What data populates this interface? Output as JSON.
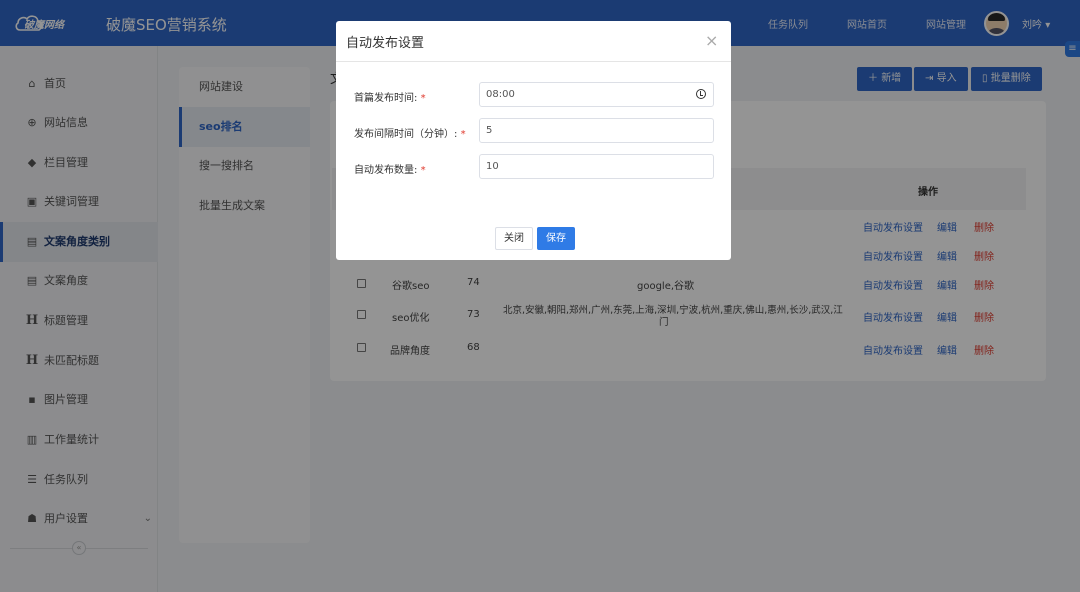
{
  "header": {
    "logo_text": "破魔网络",
    "title": "破魔SEO营销系统",
    "nav": [
      "任务队列",
      "网站首页",
      "网站管理"
    ],
    "user_name": "刘吟"
  },
  "sidebar": {
    "items": [
      {
        "label": "首页",
        "icon": "home-icon"
      },
      {
        "label": "网站信息",
        "icon": "globe-icon"
      },
      {
        "label": "栏目管理",
        "icon": "tag-icon"
      },
      {
        "label": "关键词管理",
        "icon": "file-search-icon"
      },
      {
        "label": "文案角度类别",
        "icon": "document-icon",
        "active": true
      },
      {
        "label": "文案角度",
        "icon": "document-icon"
      },
      {
        "label": "标题管理",
        "icon": "heading-icon"
      },
      {
        "label": "未匹配标题",
        "icon": "heading-icon"
      },
      {
        "label": "图片管理",
        "icon": "image-icon"
      },
      {
        "label": "工作量统计",
        "icon": "stats-icon"
      },
      {
        "label": "任务队列",
        "icon": "list-icon"
      },
      {
        "label": "用户设置",
        "icon": "users-icon"
      }
    ]
  },
  "submenu": {
    "items": [
      {
        "label": "网站建设"
      },
      {
        "label": "seo排名",
        "active": true
      },
      {
        "label": "搜一搜排名"
      },
      {
        "label": "批量生成文案"
      }
    ]
  },
  "main": {
    "heading": "文",
    "buttons": {
      "add": "新增",
      "import": "导入",
      "batch_delete": "批量删除"
    },
    "ops_header": "操作",
    "rows": [
      {
        "name": "",
        "id": "",
        "keywords": ""
      },
      {
        "name": "",
        "id": "",
        "keywords": ""
      },
      {
        "name": "谷歌seo",
        "id": "74",
        "keywords": "google,谷歌"
      },
      {
        "name": "seo优化",
        "id": "73",
        "keywords_line1": "北京,安徽,朝阳,郑州,广州,东莞,上海,深圳,宁波,杭州,重庆,佛山,惠州,长沙,武汉,江",
        "keywords_line2": "门"
      },
      {
        "name": "品牌角度",
        "id": "68",
        "keywords": ""
      }
    ],
    "actions": {
      "auto_publish": "自动发布设置",
      "edit": "编辑",
      "delete": "删除"
    }
  },
  "modal": {
    "title": "自动发布设置",
    "fields": [
      {
        "label": "首篇发布时间:",
        "value": "08:00"
      },
      {
        "label": "发布间隔时间（分钟）:",
        "value": "5"
      },
      {
        "label": "自动发布数量:",
        "value": "10"
      }
    ],
    "required_mark": "*",
    "close_label": "关闭",
    "save_label": "保存"
  }
}
